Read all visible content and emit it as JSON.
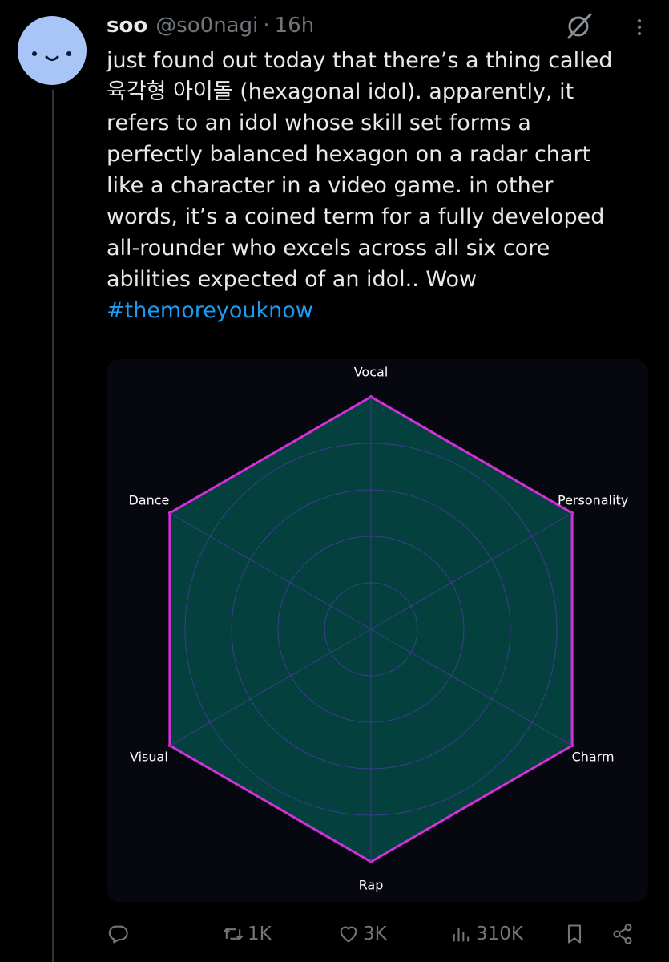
{
  "author": {
    "display_name": "soo",
    "handle": "@so0nagi",
    "separator": "·",
    "time": "16h"
  },
  "post": {
    "lines": [
      "just found out today that there’s a thing called",
      "육각형 아이돌 (hexagonal idol). apparently, it",
      "refers to an idol whose skill set forms a",
      "perfectly balanced hexagon on a radar chart",
      "like a character in a video game. in other",
      "words, it’s a coined term for a fully developed",
      "all-rounder who excels across all six core",
      "abilities expected of an idol.. Wow"
    ],
    "hashtag": "#themoreyouknow"
  },
  "chart_data": {
    "type": "radar",
    "axes": [
      "Vocal",
      "Personality",
      "Charm",
      "Rap",
      "Visual",
      "Dance"
    ],
    "series": [
      {
        "values": [
          1,
          1,
          1,
          1,
          1,
          1
        ]
      }
    ],
    "range": [
      0,
      1
    ],
    "rings": 4,
    "colors": {
      "fill": "#04403e",
      "stroke": "#d231d8",
      "grid": "#3d3d8c",
      "label": "#ffffff",
      "background": "#07070f"
    }
  },
  "actions": {
    "reply": {
      "icon": "reply-icon",
      "count": ""
    },
    "repost": {
      "icon": "repost-icon",
      "count": "1K"
    },
    "like": {
      "icon": "heart-icon",
      "count": "3K"
    },
    "views": {
      "icon": "views-icon",
      "count": "310K"
    },
    "bookmark": {
      "icon": "bookmark-icon"
    },
    "share": {
      "icon": "share-icon"
    }
  },
  "colors": {
    "background": "#000000",
    "text": "#e7e9ea",
    "muted": "#71767b",
    "link": "#1d9bf0",
    "avatar": "#a9c4f6"
  }
}
